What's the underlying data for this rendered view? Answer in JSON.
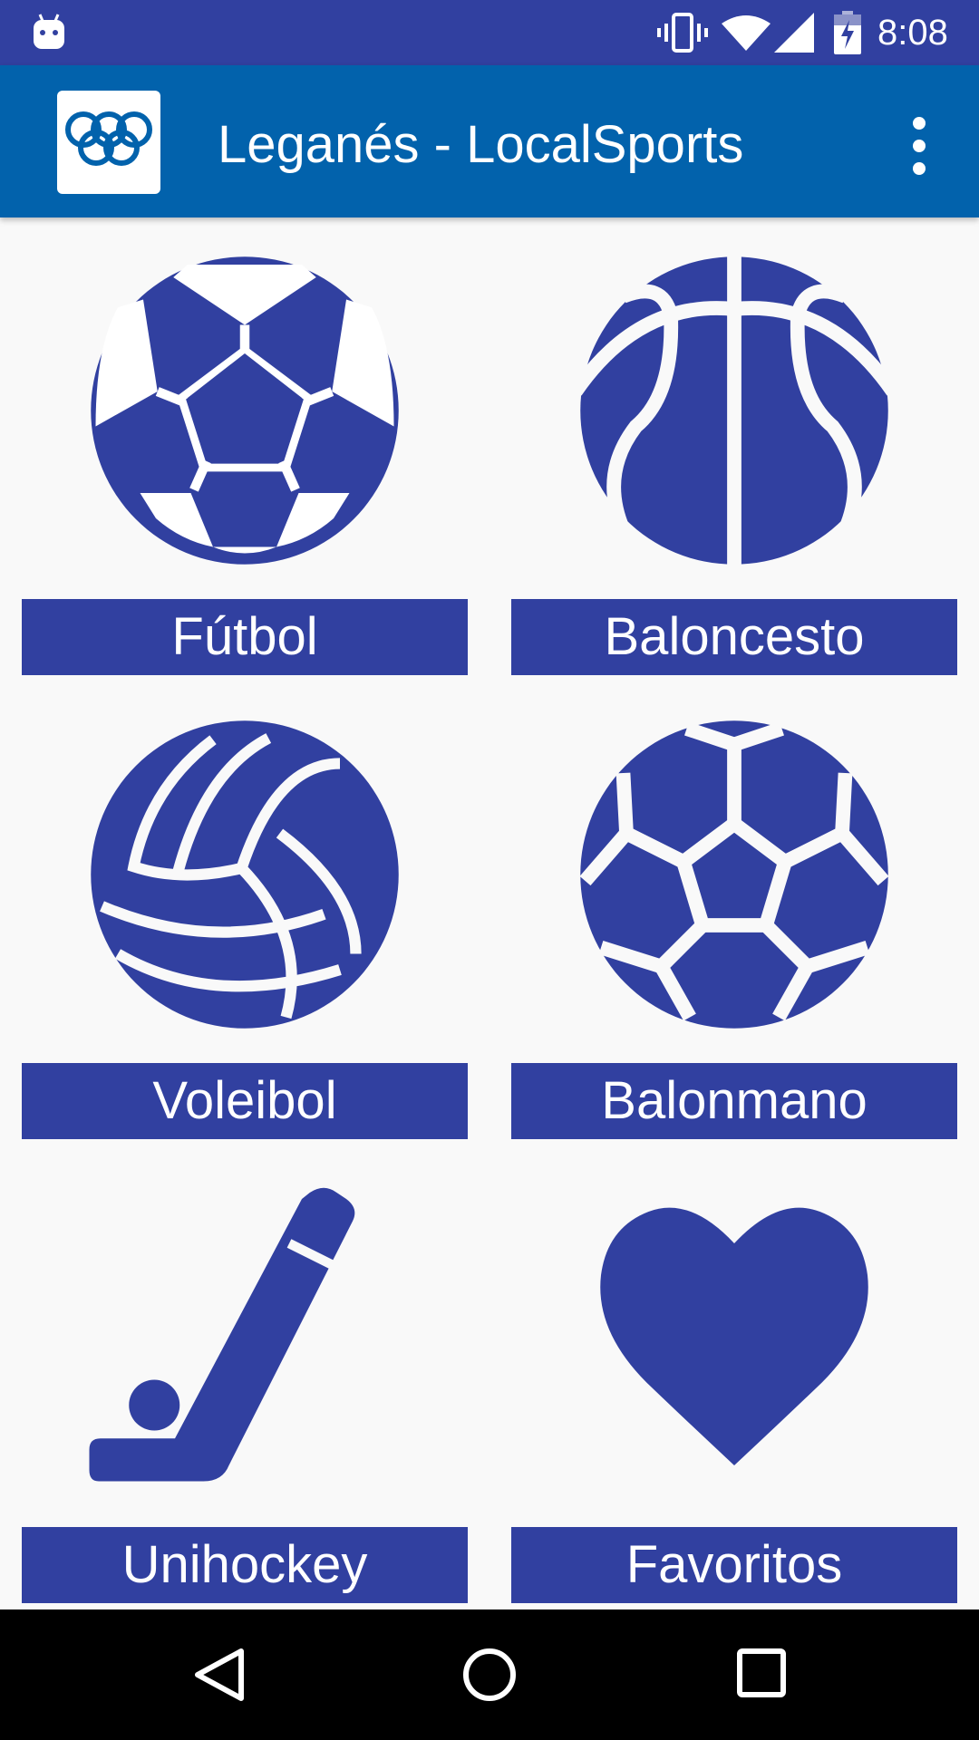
{
  "status_bar": {
    "time": "8:08",
    "icons": [
      "android-debug-icon",
      "vibrate-icon",
      "wifi-icon",
      "cell-signal-icon",
      "battery-charging-icon"
    ]
  },
  "app_bar": {
    "title": "Leganés - LocalSports",
    "logo_icon": "olympic-rings-icon",
    "menu_icon": "overflow-menu-icon"
  },
  "sports": [
    {
      "label": "Fútbol",
      "icon": "soccer-ball-icon"
    },
    {
      "label": "Baloncesto",
      "icon": "basketball-icon"
    },
    {
      "label": "Voleibol",
      "icon": "volleyball-icon"
    },
    {
      "label": "Balonmano",
      "icon": "handball-icon"
    },
    {
      "label": "Unihockey",
      "icon": "hockey-stick-icon"
    },
    {
      "label": "Favoritos",
      "icon": "heart-icon"
    }
  ],
  "nav_bar": {
    "icons": [
      "back-icon",
      "home-icon",
      "recents-icon"
    ]
  },
  "colors": {
    "status_bar": "#3140a0",
    "app_bar": "#0262ac",
    "accent": "#3140a0",
    "background": "#f9f9f9"
  }
}
